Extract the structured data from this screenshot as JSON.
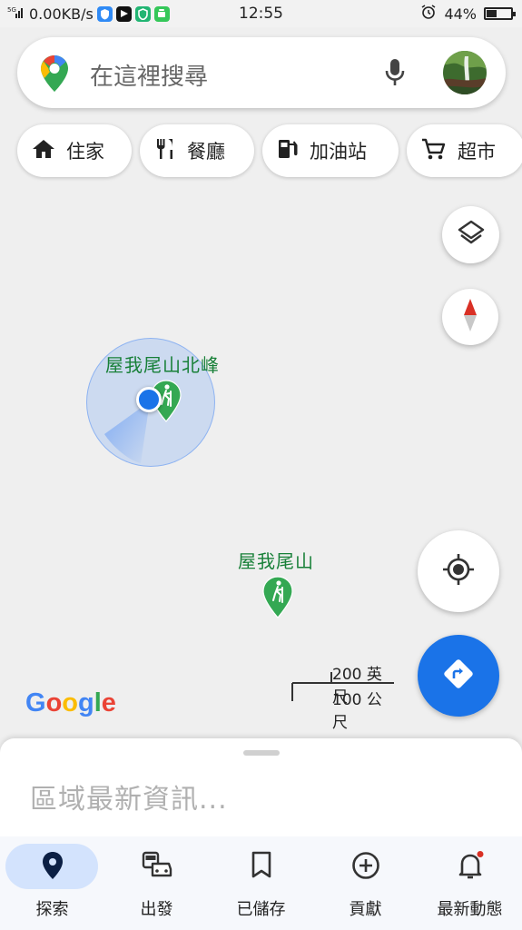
{
  "status_bar": {
    "signal": "5G",
    "speed": "0.00KB/s",
    "time": "12:55",
    "battery": "44%",
    "battery_level": 0.44
  },
  "search": {
    "placeholder": "在這裡搜尋",
    "icons": [
      "maps-pin-icon",
      "microphone-icon",
      "avatar"
    ]
  },
  "chips": [
    {
      "label": "住家",
      "icon": "home-icon"
    },
    {
      "label": "餐廳",
      "icon": "restaurant-icon"
    },
    {
      "label": "加油站",
      "icon": "gas-station-icon"
    },
    {
      "label": "超市",
      "icon": "shopping-cart-icon"
    }
  ],
  "map": {
    "places": [
      {
        "name": "屋我尾山北峰",
        "icon": "hiking-icon"
      },
      {
        "name": "屋我尾山",
        "icon": "hiking-icon"
      }
    ],
    "scale": {
      "imperial": "200 英尺",
      "metric": "100 公尺"
    },
    "logo": "Google",
    "controls": [
      "layers-icon",
      "compass-icon",
      "my-location-icon",
      "directions-icon"
    ]
  },
  "sheet": {
    "title": "區域最新資訊..."
  },
  "nav": [
    {
      "label": "探索",
      "icon": "explore-pin-icon",
      "active": true
    },
    {
      "label": "出發",
      "icon": "commute-icon",
      "active": false
    },
    {
      "label": "已儲存",
      "icon": "bookmark-icon",
      "active": false
    },
    {
      "label": "貢獻",
      "icon": "add-circle-icon",
      "active": false
    },
    {
      "label": "最新動態",
      "icon": "bell-icon",
      "active": false,
      "badge": true
    }
  ],
  "colors": {
    "accent_blue": "#1a73e8",
    "map_green": "#188038",
    "nav_active": "#d3e3fd",
    "badge_red": "#d93025"
  }
}
